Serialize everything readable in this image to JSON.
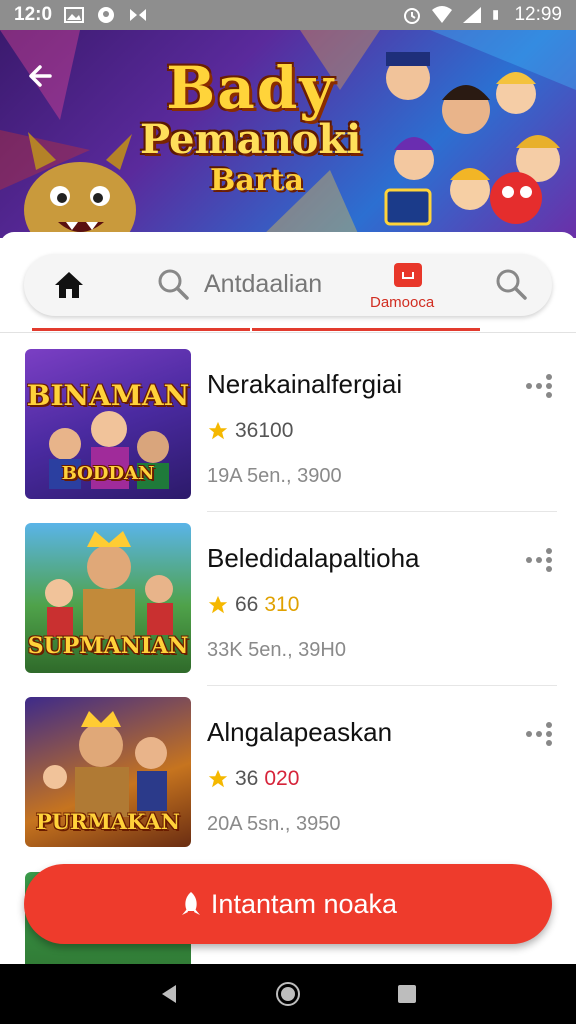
{
  "status_bar": {
    "left_time": "12:0",
    "right_time": "12:99",
    "icons": [
      "image-icon",
      "location-icon",
      "cast-icon",
      "alarm-icon",
      "wifi-icon",
      "signal-icon",
      "battery-icon"
    ]
  },
  "banner": {
    "title_line1": "Bady",
    "title_line2": "Pemanoki",
    "title_line3": "Barta",
    "back_icon": "back-arrow-icon"
  },
  "search_bar": {
    "placeholder": "Antdaalian",
    "active_tab_label": "Damooca",
    "icons": [
      "home-icon",
      "search-icon",
      "tab-badge-icon",
      "search-icon"
    ]
  },
  "list": {
    "items": [
      {
        "title": "Nerakainalfergiai",
        "rating": "36100",
        "meta": "19A 5en., 3900",
        "thumb_title_top": "BINAMAN",
        "thumb_title_bottom": "BODDAN"
      },
      {
        "title": "Beledidalapaltioha",
        "rating_prefix": "66",
        "rating_suffix": "310",
        "meta": "33K 5en., 39H0",
        "thumb_title_bottom": "SUPMANIAN"
      },
      {
        "title": "Alngalapeaskan",
        "rating_prefix": "36",
        "rating_suffix": "020",
        "meta": "20A 5sn., 3950",
        "thumb_title_bottom": "PURMAKAN"
      }
    ]
  },
  "fab": {
    "label": "Intantam noaka",
    "icon": "rocket-icon"
  },
  "colors": {
    "accent": "#ee3b2c",
    "status_bar": "#8e8e8e",
    "star": "#f5b800"
  },
  "nav_bar": {
    "icons": [
      "back-triangle-icon",
      "home-circle-icon",
      "recents-square-icon"
    ]
  }
}
